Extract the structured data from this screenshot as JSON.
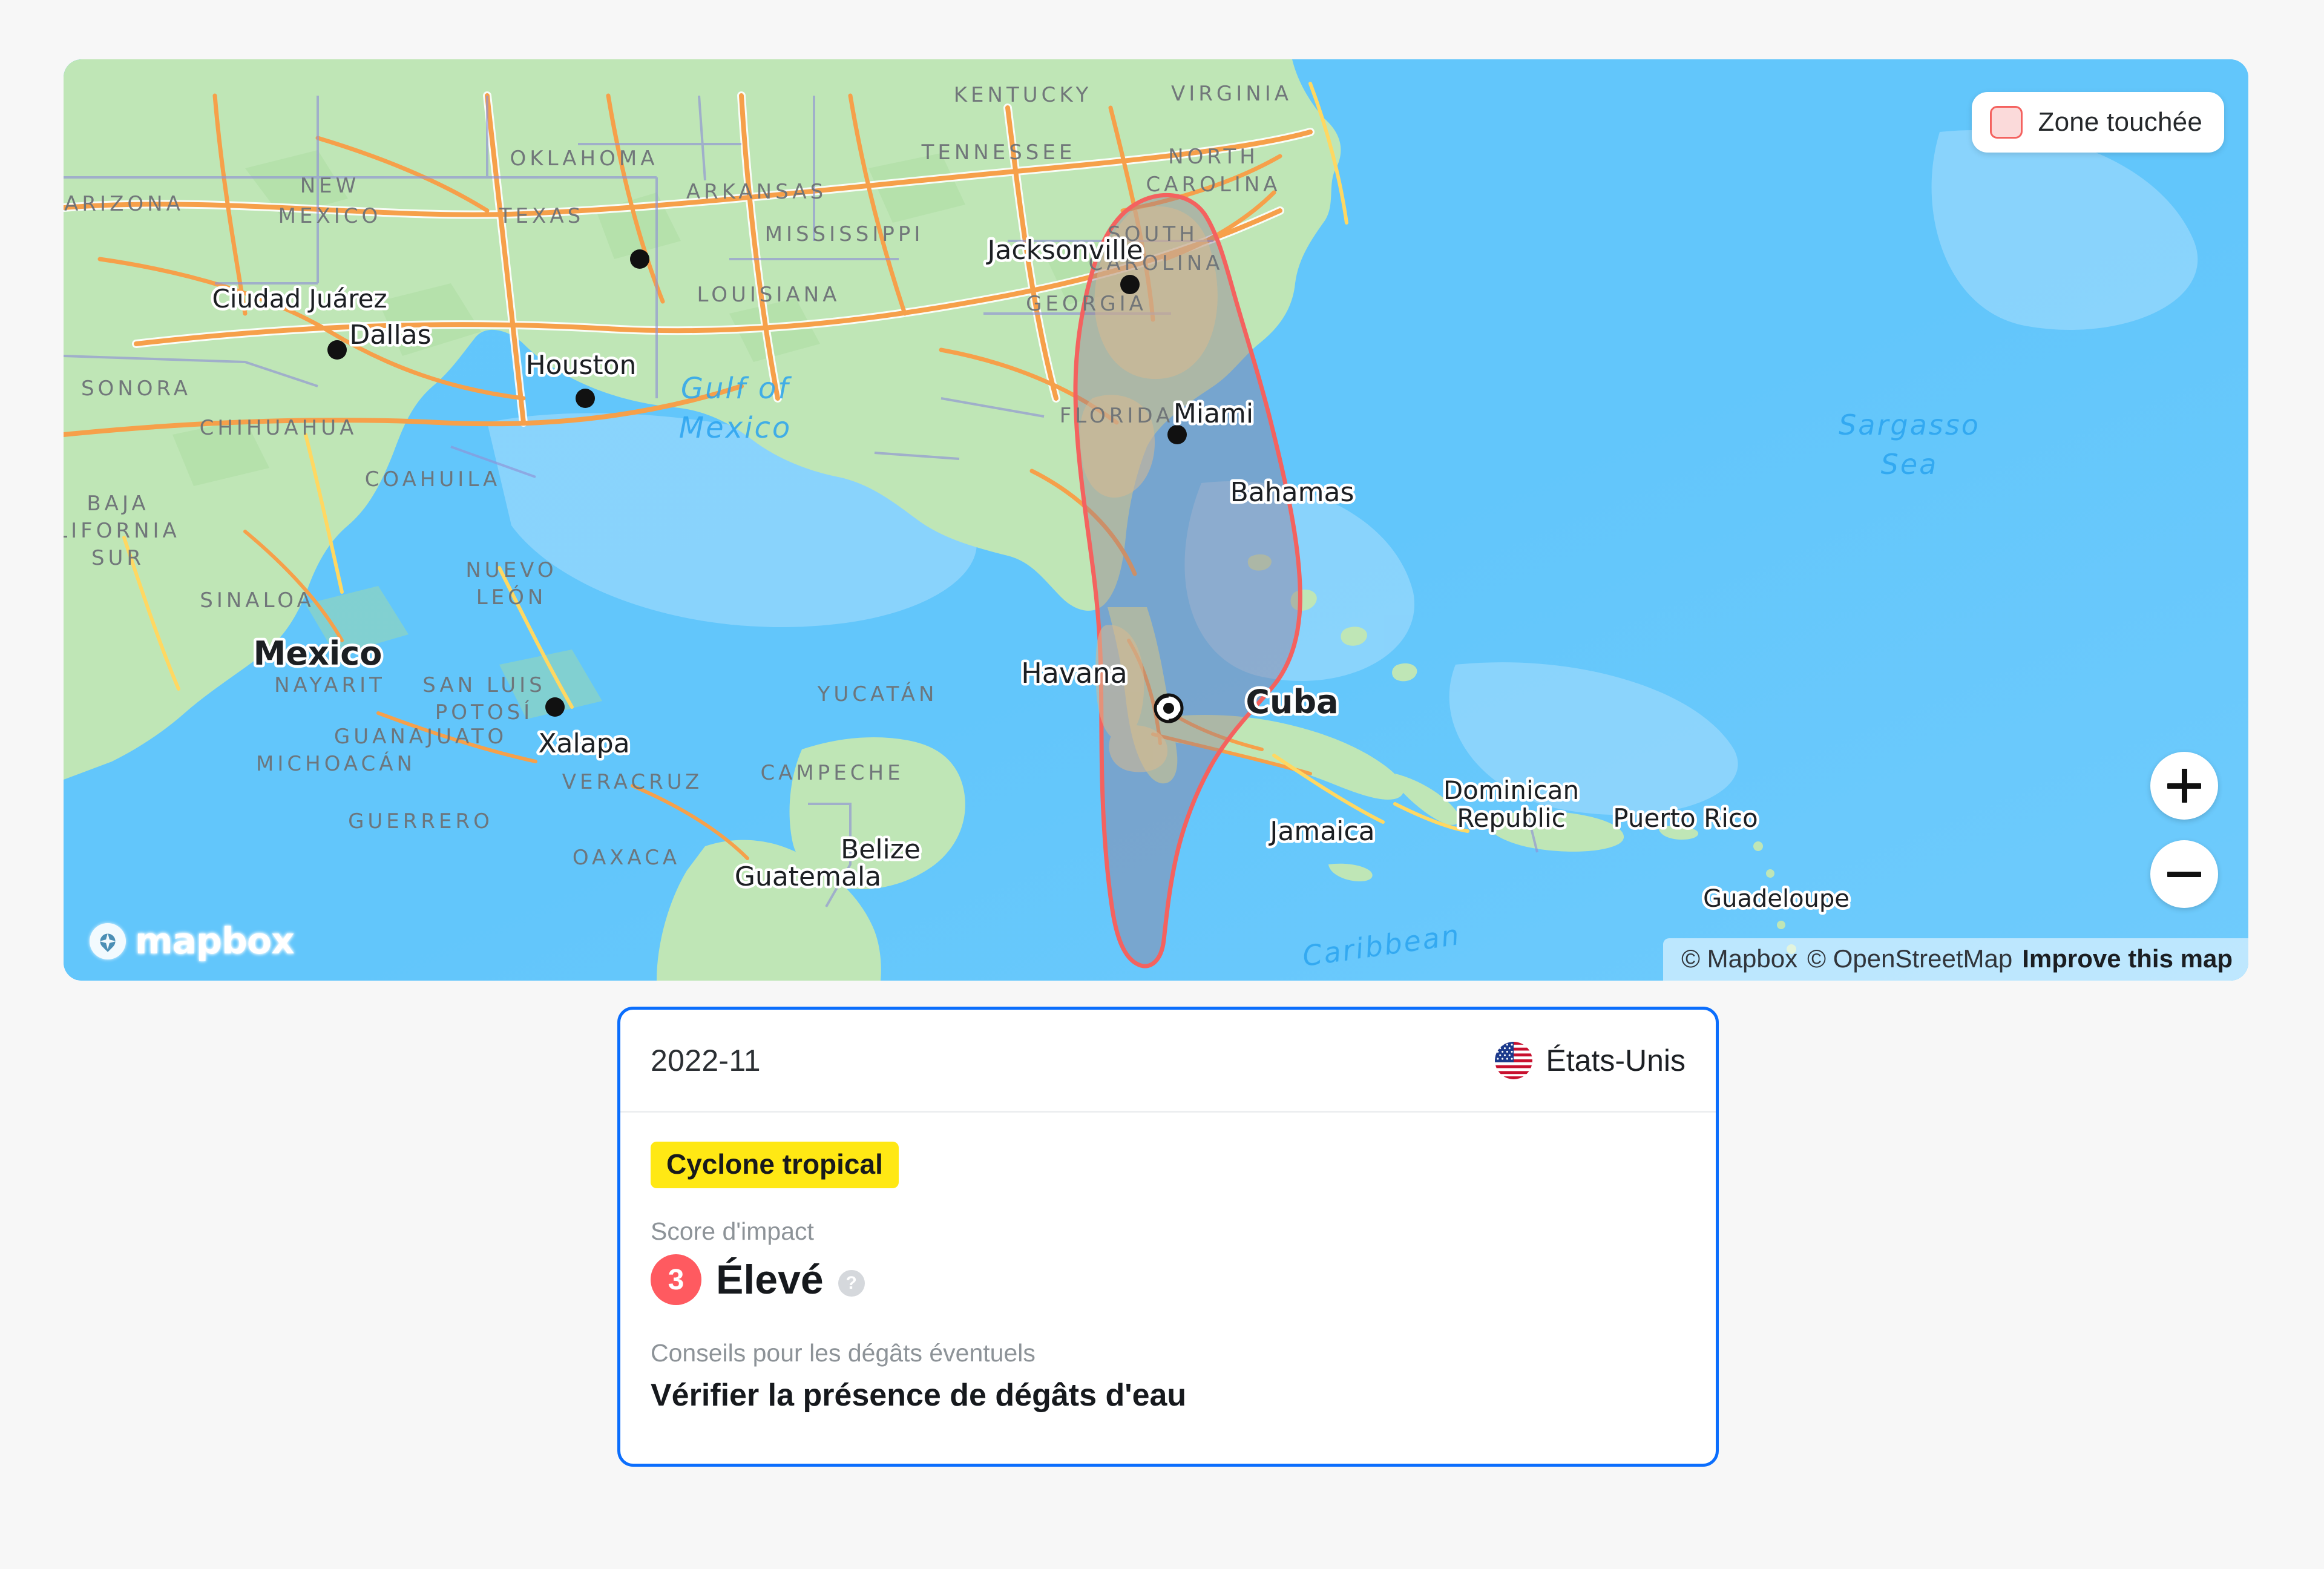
{
  "map": {
    "legend": {
      "label": "Zone touchée",
      "swatch_fill": "#fbdada",
      "swatch_border": "#f4625f"
    },
    "zoom_in_label": "+",
    "zoom_out_label": "−",
    "logo_text": "mapbox",
    "attribution": {
      "mapbox": "© Mapbox",
      "osm": "© OpenStreetMap",
      "improve": "Improve this map"
    },
    "water_labels": [
      {
        "name": "Gulf of Mexico",
        "line1": "Gulf of",
        "line2": "Mexico"
      },
      {
        "name": "Sargasso Sea",
        "line1": "Sargasso",
        "line2": "Sea"
      },
      {
        "name": "Caribbean Sea",
        "line1": "Caribbean",
        "line2": ""
      }
    ],
    "state_labels": [
      "ARIZONA",
      "NEW MEXICO",
      "OKLAHOMA",
      "ARKANSAS",
      "TENNESSEE",
      "KENTUCKY",
      "VIRGINIA",
      "NORTH CAROLINA",
      "SOUTH CAROLINA",
      "GEORGIA",
      "FLORIDA",
      "MISSISSIPPI",
      "LOUISIANA",
      "TEXAS",
      "SONORA",
      "CHIHUAHUA",
      "COAHUILA",
      "NUEVO LEÓN",
      "BAJA CALIFORNIA SUR",
      "SINALOA",
      "NAYARIT",
      "SAN LUIS POTOSÍ",
      "GUANAJUATO",
      "MICHOACÁN",
      "VERACRUZ",
      "GUERRERO",
      "OAXACA",
      "CAMPECHE",
      "YUCATÁN"
    ],
    "country_labels": [
      "Mexico",
      "Cuba",
      "Bahamas",
      "Jamaica",
      "Belize",
      "Guatemala",
      "Dominican Republic",
      "Puerto Rico",
      "Guadeloupe"
    ],
    "city_labels": [
      "Ciudad Juárez",
      "Dallas",
      "Houston",
      "Jacksonville",
      "Miami",
      "Havana",
      "Xalapa"
    ],
    "impact_zone": {
      "stroke": "#f4625f",
      "fill": "rgba(172,126,122,0.45)"
    },
    "storm_marker": "cyclone-marker"
  },
  "card": {
    "date": "2022-11",
    "country": "États-Unis",
    "flag": "us-flag-icon",
    "event_type": "Cyclone tropical",
    "score_label": "Score d'impact",
    "score_value": "3",
    "score_text": "Élevé",
    "help": "?",
    "advice_label": "Conseils pour les dégâts éventuels",
    "advice_text": "Vérifier la présence de dégâts d'eau",
    "accent_border": "#0b6efd",
    "badge_bg": "#ffe814",
    "score_pill_bg": "#ff5a60"
  }
}
